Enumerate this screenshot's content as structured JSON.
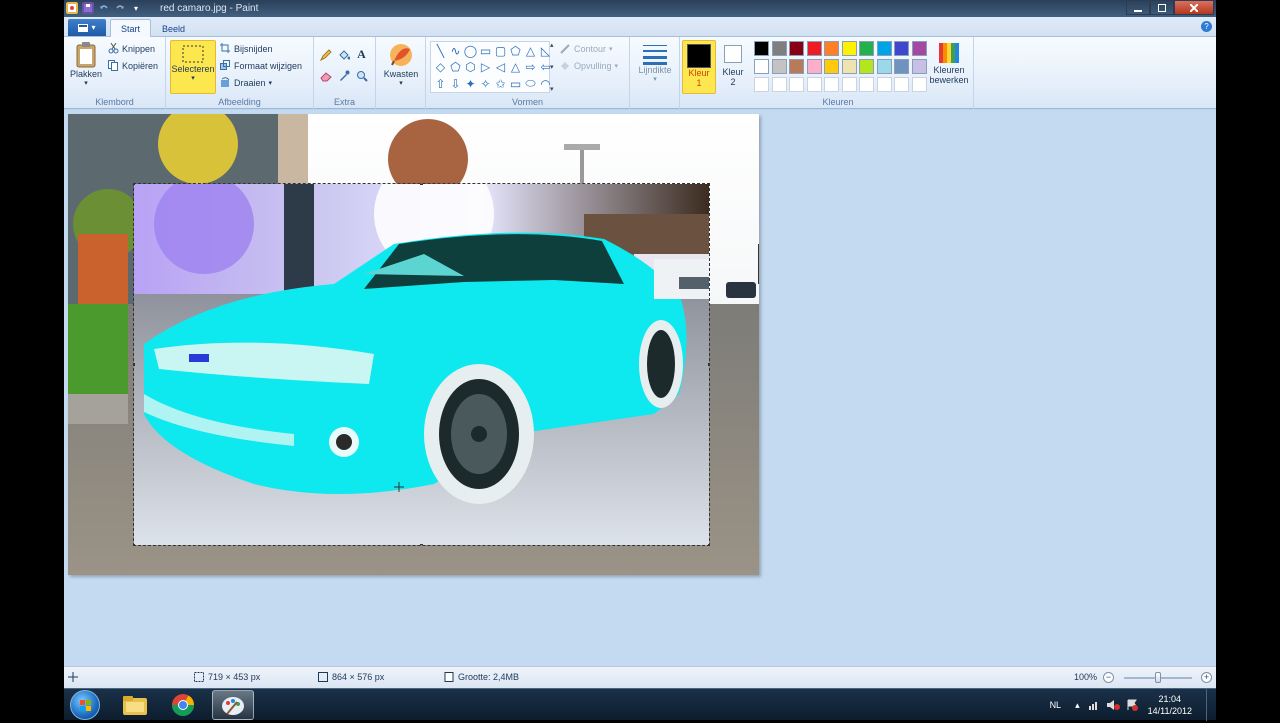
{
  "window": {
    "title": "red camaro.jpg - Paint",
    "qat_icons": [
      "paint-icon",
      "save-icon",
      "undo-icon",
      "redo-icon",
      "customize-icon"
    ],
    "controls": [
      "minimize",
      "maximize",
      "close"
    ]
  },
  "tabs": [
    {
      "label": "Start",
      "active": true
    },
    {
      "label": "Beeld",
      "active": false
    }
  ],
  "ribbon": {
    "klembord": {
      "label": "Klembord",
      "plakken": "Plakken",
      "knippen": "Knippen",
      "kopieren": "Kopiëren"
    },
    "afbeelding": {
      "label": "Afbeelding",
      "selecteren": "Selecteren",
      "bijsnijden": "Bijsnijden",
      "formaat": "Formaat wijzigen",
      "draaien": "Draaien"
    },
    "extra": {
      "label": "Extra",
      "tools": [
        "pencil-icon",
        "fill-icon",
        "text-icon",
        "eraser-icon",
        "color-picker-icon",
        "magnifier-icon"
      ],
      "text_tool_glyph": "A"
    },
    "kwasten": {
      "label": "Kwasten"
    },
    "vormen": {
      "label": "Vormen",
      "contour": "Contour",
      "opvulling": "Opvulling",
      "shapes": [
        "╲",
        "∿",
        "◯",
        "▭",
        "▢",
        "⬠",
        "△",
        "◺",
        "◇",
        "⬠",
        "⬡",
        "▷",
        "◁",
        "△",
        "⇨",
        "⇦",
        "⇧",
        "⇩",
        "✦",
        "✧",
        "✩",
        "▭",
        "⬭",
        "◠"
      ]
    },
    "lijndikte": {
      "label": "Lijndikte"
    },
    "kleur1": {
      "label": "Kleur",
      "number": "1",
      "color": "#000000"
    },
    "kleur2": {
      "label": "Kleur",
      "number": "2",
      "color": "#ffffff"
    },
    "kleuren": {
      "label": "Kleuren",
      "bewerken": "Kleuren bewerken",
      "palette_row1": [
        "#000000",
        "#7f7f7f",
        "#880015",
        "#ed1c24",
        "#ff7f27",
        "#fff200",
        "#22b14c",
        "#00a2e8",
        "#3f48cc",
        "#a349a4"
      ],
      "palette_row2": [
        "#ffffff",
        "#c3c3c3",
        "#b97a57",
        "#ffaec9",
        "#ffc90e",
        "#efe4b0",
        "#b5e61d",
        "#99d9ea",
        "#7092be",
        "#c8bfe7"
      ]
    }
  },
  "status": {
    "selection_size": "719 × 453 px",
    "image_size": "864 × 576 px",
    "file_size": "Grootte: 2,4MB",
    "zoom": "100%"
  },
  "taskbar": {
    "apps": [
      "explorer-icon",
      "chrome-icon",
      "paint-icon"
    ],
    "language": "NL",
    "time": "21:04",
    "date": "14/11/2012"
  }
}
